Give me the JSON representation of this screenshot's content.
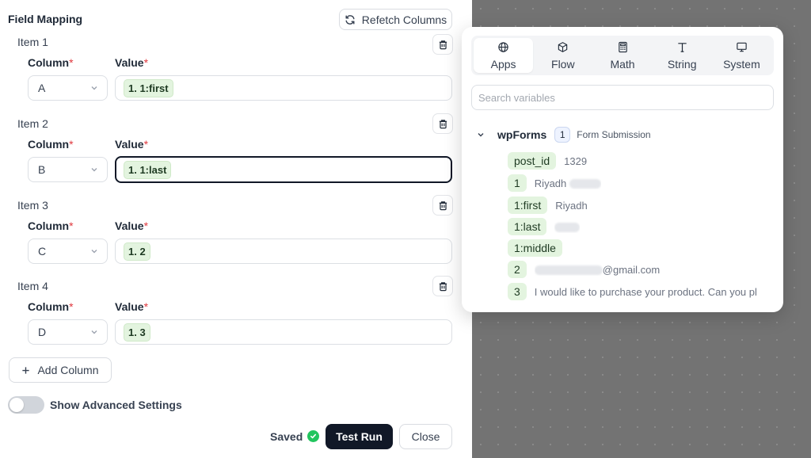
{
  "field_mapping": {
    "title": "Field Mapping",
    "refetch_label": "Refetch Columns",
    "column_label": "Column",
    "value_label": "Value",
    "required_mark": "*",
    "items": [
      {
        "title": "Item 1",
        "column": "A",
        "value_chip": "1. 1:first"
      },
      {
        "title": "Item 2",
        "column": "B",
        "value_chip": "1. 1:last"
      },
      {
        "title": "Item 3",
        "column": "C",
        "value_chip": "1. 2"
      },
      {
        "title": "Item 4",
        "column": "D",
        "value_chip": "1. 3"
      }
    ],
    "add_column_label": "Add Column",
    "advanced_label": "Show Advanced Settings",
    "advanced_enabled": false
  },
  "footer": {
    "saved_label": "Saved",
    "test_run_label": "Test Run",
    "close_label": "Close"
  },
  "popover": {
    "tabs": [
      {
        "label": "Apps",
        "icon": "globe-icon"
      },
      {
        "label": "Flow",
        "icon": "cube-icon"
      },
      {
        "label": "Math",
        "icon": "calculator-icon"
      },
      {
        "label": "String",
        "icon": "text-icon"
      },
      {
        "label": "System",
        "icon": "monitor-icon"
      }
    ],
    "active_tab": "Apps",
    "search_placeholder": "Search variables",
    "group": {
      "name": "wpForms",
      "count": "1",
      "description": "Form Submission"
    },
    "variables": [
      {
        "key": "post_id",
        "value": "1329"
      },
      {
        "key": "1",
        "value": "Riyadh"
      },
      {
        "key": "1:first",
        "value": "Riyadh"
      },
      {
        "key": "1:last",
        "value": ""
      },
      {
        "key": "1:middle",
        "value": ""
      },
      {
        "key": "2",
        "value": "@gmail.com"
      },
      {
        "key": "3",
        "value": "I would like to purchase your product. Can you pl"
      }
    ]
  },
  "colors": {
    "accent_dark": "#111827",
    "chip_green": "#e3f4df",
    "required_red": "#e0383e",
    "saved_green": "#22c55e",
    "canvas_gray": "#737373"
  }
}
